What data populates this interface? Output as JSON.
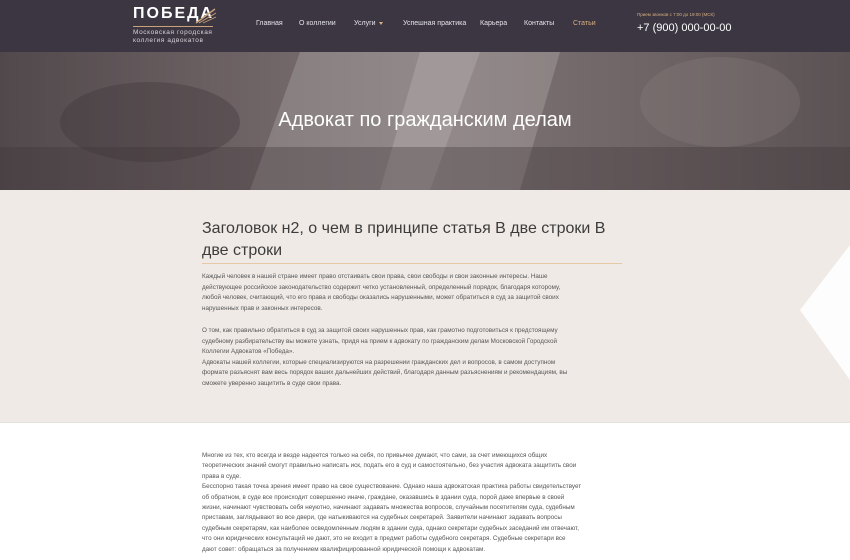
{
  "header": {
    "logo_title": "ПОБЕДА",
    "logo_sub_line1": "Московская городская",
    "logo_sub_line2": "коллегия адвокатов",
    "nav": [
      {
        "label": "Главная"
      },
      {
        "label": "О коллегии"
      },
      {
        "label": "Услуги",
        "has_dropdown": true
      },
      {
        "label": "Успешная практика"
      },
      {
        "label": "Карьера"
      },
      {
        "label": "Контакты"
      },
      {
        "label": "Статьи",
        "active": true
      }
    ],
    "hours": "Прием звонков с 7:00 до 19:00 (МСК)",
    "phone": "+7 (900) 000-00-00"
  },
  "hero": {
    "title": "Адвокат по гражданским делам"
  },
  "article": {
    "h2_line1": "Заголовок н2, о чем в принципе статья В две строки В",
    "h2_line2": "две строки",
    "p1": [
      "Каждый человек в нашей стране имеет право отстаивать свои права, свои свободы и свои законные интересы. Наше",
      "действующее российское законодательство содержит четко установленный, определенный порядок, благодаря которому,",
      "любой человек, считающий, что его права и свободы оказались нарушенными, может обратиться в суд за защитой своих",
      "нарушенных прав и законных интересов."
    ],
    "p2": [
      "О том, как правильно обратиться в суд за защитой своих нарушенных прав, как грамотно подготовиться к предстоящему",
      "судебному разбирательству вы можете узнать, придя на прием к адвокату по гражданским делам Московской Городской",
      "Коллегии Адвокатов «Победа».",
      "Адвокаты нашей коллегии, которые специализируются на разрешении гражданских дел и вопросов, в самом доступном",
      "формате разъяснят вам весь порядок ваших дальнейших действий, благодаря данным разъяснениям и рекомендациям, вы",
      "сможете уверенно защитить в суде свои права."
    ],
    "p3": [
      "Многие из тех, кто всегда и везде надеется только на себя, по привычке думают, что сами, за счет имеющихся общих",
      "теоретических знаний смогут правильно написать иск, подать его в суд и самостоятельно, без участия адвоката защитить свои",
      "права в суде.",
      "Бесспорно такая точка зрения имеет право на свое существование. Однако наша адвокатская практика работы свидетельствует",
      "об обратном, в суде все происходит совершенно иначе, граждане, оказавшись в здании суда, порой даже впервые в своей",
      "жизни, начинают чувствовать себя неуютно, начинают задавать множества вопросов, случайным посетителям суда, судебным",
      "приставам, заглядывают во все двери, где натыкиваются на судебных секретарей. Заявители начинают задавать вопросы",
      "судебным секретарям, как наиболее осведомленным людям в здании суда, однако секретари судебных заседаний им отвечают,",
      "что они юридических консультаций не дают, это не входит в предмет работы судебного секретаря. Судебные секретари все",
      "дают совет: обращаться за получением квалифицированной юридической помощи к адвокатам."
    ]
  },
  "colors": {
    "header_bg": "#3b3641",
    "accent": "#d8b081",
    "beige_bg": "#efeae6"
  }
}
